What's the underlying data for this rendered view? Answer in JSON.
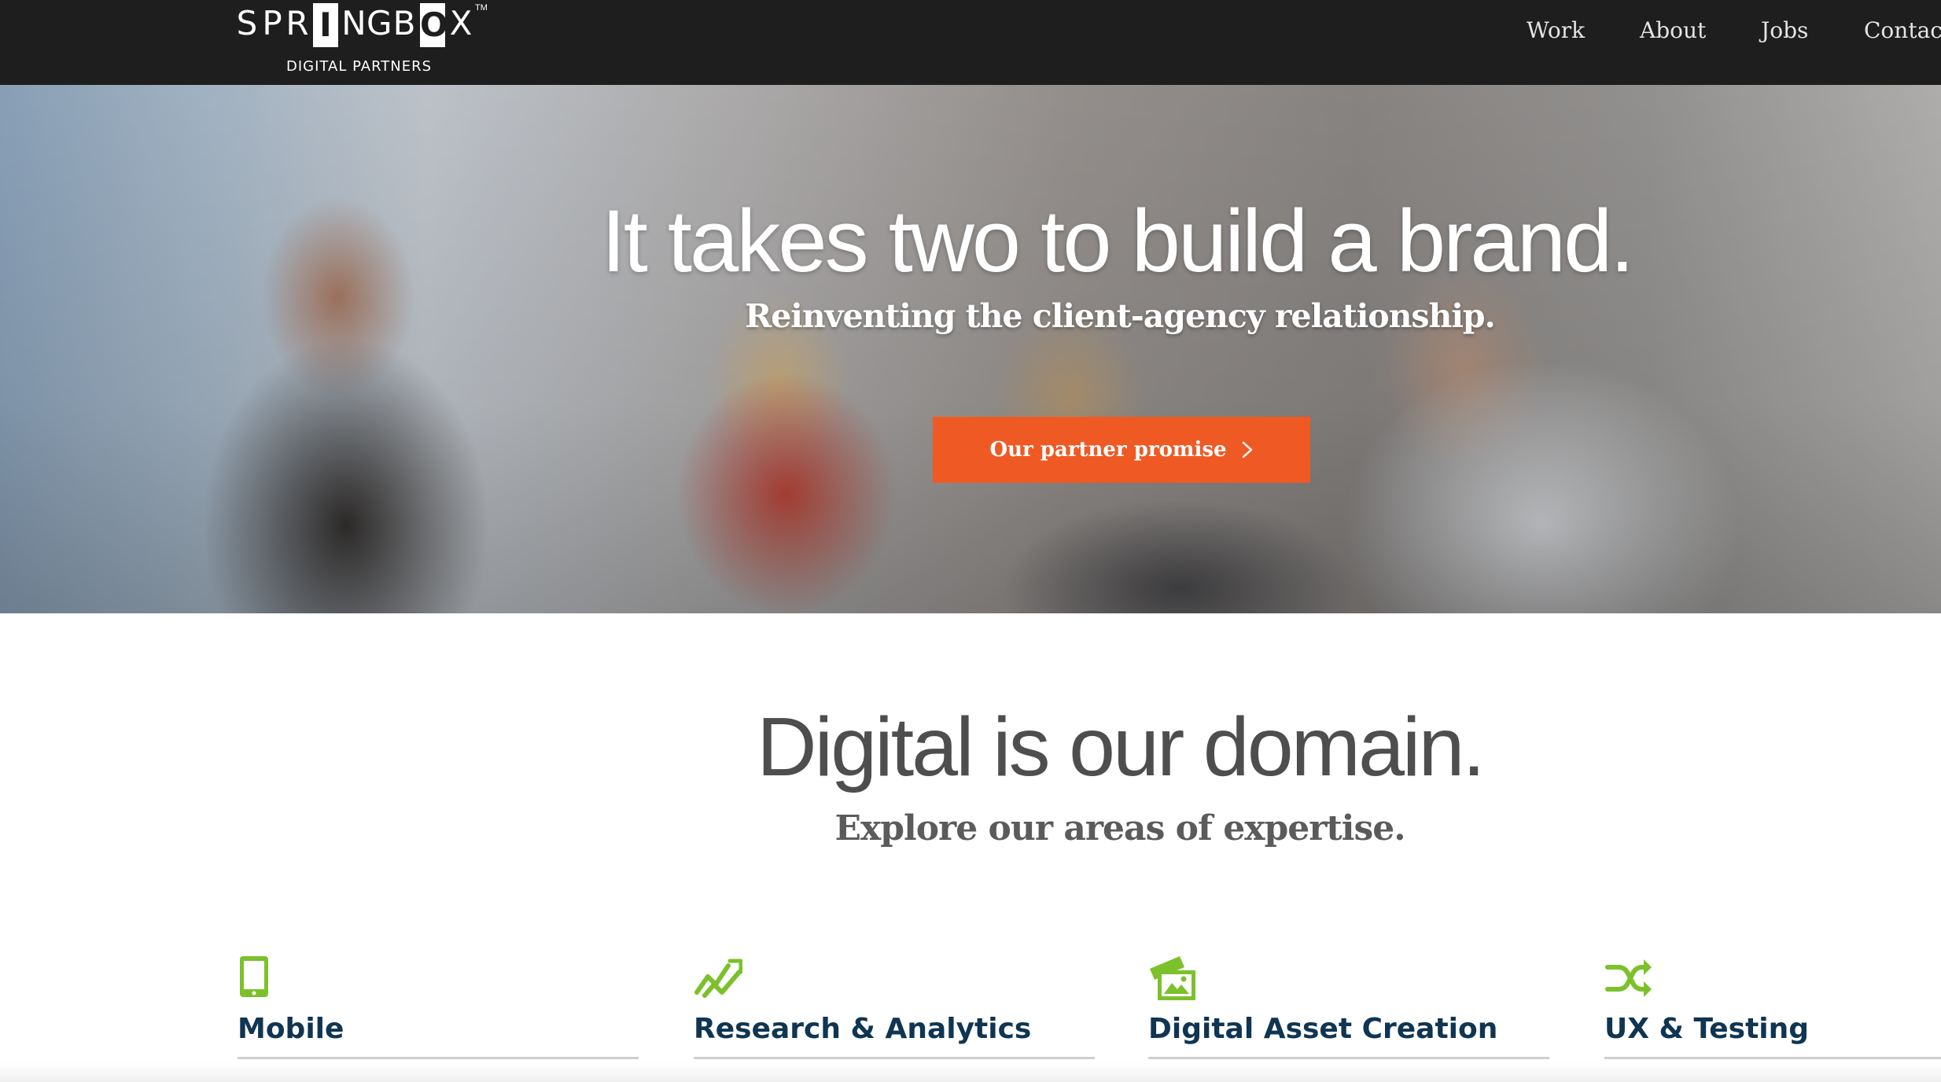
{
  "header": {
    "logo": {
      "letters": [
        "S",
        "P",
        "R",
        "I",
        "N",
        "G",
        "B",
        "O",
        "X"
      ],
      "trademark": "TM",
      "tagline": "DIGITAL PARTNERS"
    },
    "nav": [
      {
        "label": "Work"
      },
      {
        "label": "About"
      },
      {
        "label": "Jobs"
      },
      {
        "label": "Contact"
      }
    ]
  },
  "hero": {
    "title": "It takes two to build a brand.",
    "subtitle": "Reinventing the client-agency relationship.",
    "button_label": "Our partner promise",
    "button_icon": "chevron-right-icon",
    "button_color": "#ef5a24"
  },
  "expertise": {
    "title": "Digital is our domain.",
    "subtitle": "Explore our areas of expertise.",
    "accent_color": "#7cc12c",
    "label_color": "#0f3552",
    "services": [
      {
        "label": "Mobile",
        "icon": "tablet-icon"
      },
      {
        "label": "Research & Analytics",
        "icon": "trend-chart-icon"
      },
      {
        "label": "Digital Asset Creation",
        "icon": "photos-icon"
      },
      {
        "label": "UX & Testing",
        "icon": "shuffle-icon"
      }
    ]
  }
}
